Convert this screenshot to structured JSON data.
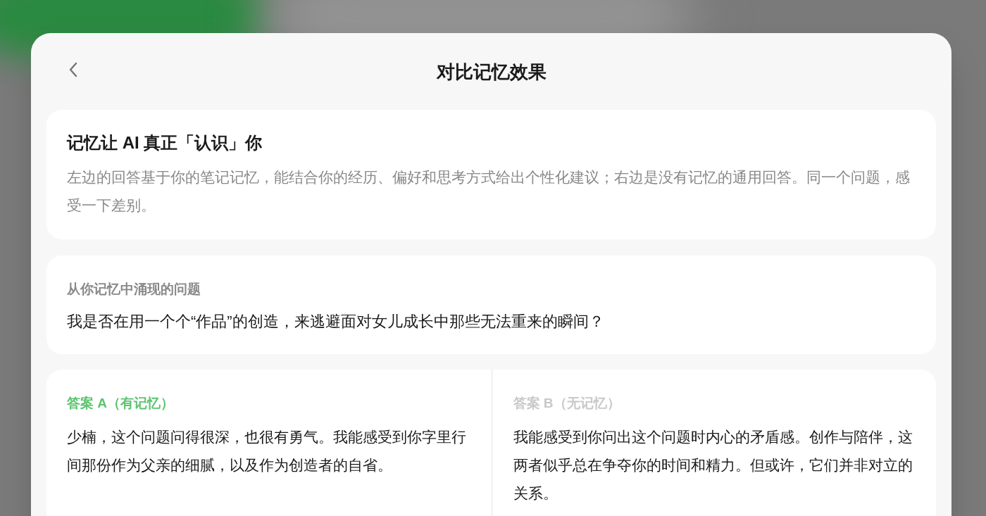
{
  "header": {
    "title": "对比记忆效果"
  },
  "intro": {
    "title": "记忆让 AI 真正「认识」你",
    "description": "左边的回答基于你的笔记记忆，能结合你的经历、偏好和思考方式给出个性化建议；右边是没有记忆的通用回答。同一个问题，感受一下差别。"
  },
  "question": {
    "label": "从你记忆中涌现的问题",
    "text": "我是否在用一个个“作品”的创造，来逃避面对女儿成长中那些无法重来的瞬间？"
  },
  "answers": [
    {
      "label": "答案 A（有记忆）",
      "color": "#5ac46e",
      "text": "少楠，这个问题问得很深，也很有勇气。我能感受到你字里行间那份作为父亲的细腻，以及作为创造者的自省。"
    },
    {
      "label": "答案 B（无记忆）",
      "color": "#c8c8c8",
      "text": "我能感受到你问出这个问题时内心的矛盾感。创作与陪伴，这两者似乎总在争夺你的时间和精力。但或许，它们并非对立的关系。"
    }
  ]
}
